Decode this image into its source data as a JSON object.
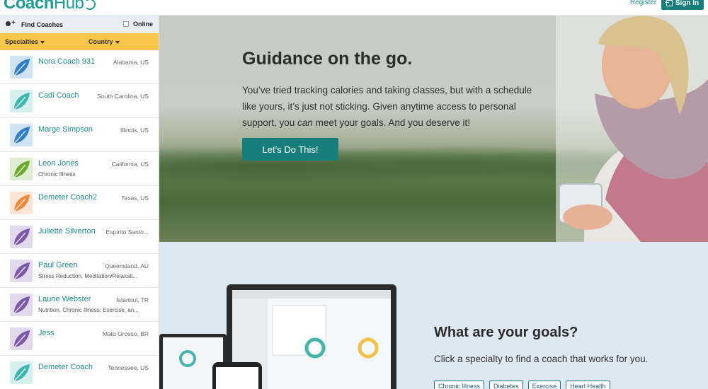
{
  "header": {
    "logo_main": "Coach",
    "logo_hub": "Hub",
    "register_label": "Register",
    "signin_label": "Sign In"
  },
  "sidebar": {
    "find_label": "Find Coaches",
    "online_label": "Online",
    "specialties_label": "Specialties",
    "country_label": "Country",
    "coaches": [
      {
        "name": "Nora Coach 931",
        "location": "Alabama, US",
        "tags": "",
        "color": "#2f7fc4"
      },
      {
        "name": "Cadi Coach",
        "location": "South Carolina, US",
        "tags": "",
        "color": "#3cb8b0"
      },
      {
        "name": "Marge Simpson",
        "location": "Illinois, US",
        "tags": "",
        "color": "#2f7fc4"
      },
      {
        "name": "Leon Jones",
        "location": "California, US",
        "tags": "Chronic Illness",
        "color": "#6aa82e"
      },
      {
        "name": "Demeter Coach2",
        "location": "Texas, US",
        "tags": "",
        "color": "#f08a3a"
      },
      {
        "name": "Juliette Silverton",
        "location": "Espírito Santo...",
        "tags": "",
        "color": "#7d57a8"
      },
      {
        "name": "Paul Green",
        "location": "Queensland, AU",
        "tags": "Stress Reduction, Meditation/Relaxati...",
        "color": "#7d57a8"
      },
      {
        "name": "Laurie Webster",
        "location": "İstanbul, TR",
        "tags": "Nutrition, Chronic Illness, Exercise, an...",
        "color": "#7d57a8"
      },
      {
        "name": "Jess",
        "location": "Mato Grosso, BR",
        "tags": "",
        "color": "#7d57a8"
      },
      {
        "name": "Demeter Coach",
        "location": "Tennessee, US",
        "tags": "",
        "color": "#3cb8b0"
      }
    ]
  },
  "hero": {
    "title": "Guidance on the go.",
    "text_before": "You’ve tried tracking calories and taking classes, but with a schedule like yours, it’s just not sticking. Given anytime access to personal support, you ",
    "text_em": "can",
    "text_after": " meet your goals. And you deserve it!",
    "button_label": "Let’s Do This!"
  },
  "goals": {
    "title": "What are your goals?",
    "subtitle": "Click a specialty to find a coach that works for you.",
    "tags": [
      "Chronic Illness",
      "Diabetes",
      "Exercise",
      "Heart Health"
    ]
  },
  "colors": {
    "brand": "#1f9a96",
    "accent_yellow": "#f7c54a",
    "button": "#177f7b"
  }
}
